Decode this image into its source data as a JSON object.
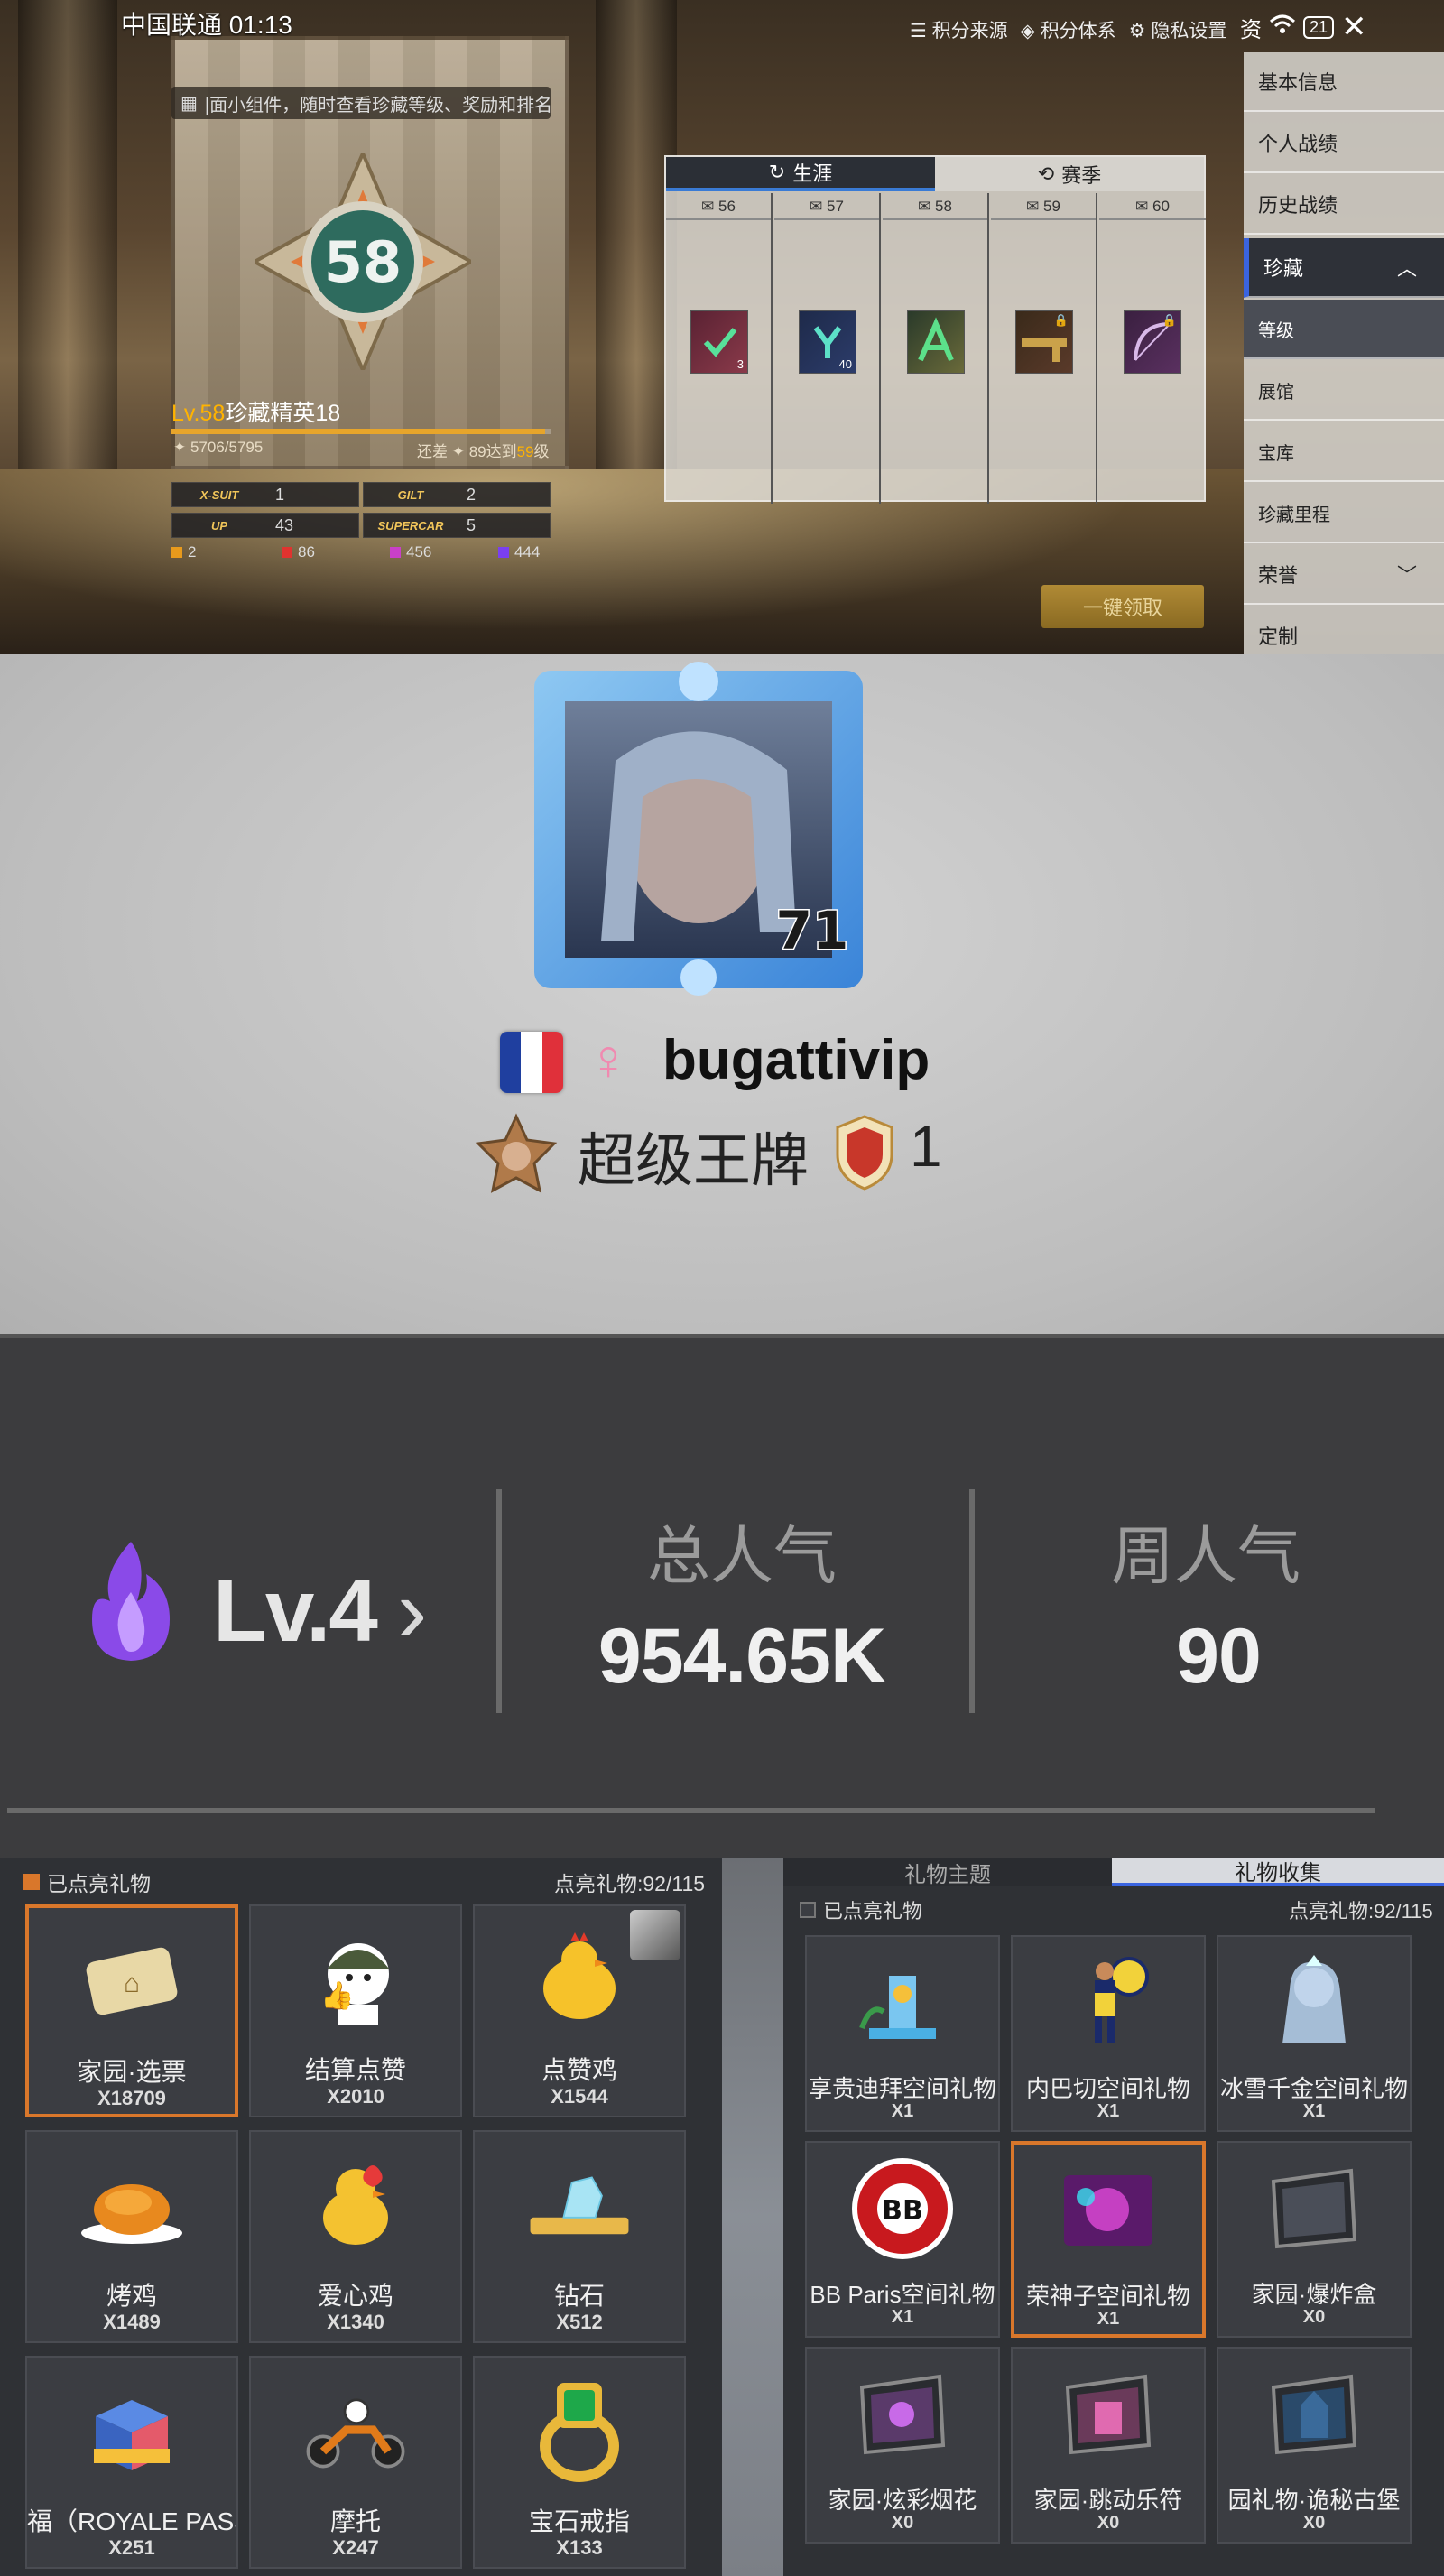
{
  "status": {
    "carrier_time": "中国联通 01:13",
    "battery": "21"
  },
  "top_links": [
    "积分来源",
    "积分体系",
    "隐私设置"
  ],
  "tip_banner": "|面小组件，随时查看珍藏等级、奖励和排名",
  "badge_level": "58",
  "level_line": {
    "lv": "Lv.58",
    "title": "珍藏精英18"
  },
  "xp": {
    "text": "5706/5795",
    "fraction": 0.985,
    "remain_prefix": "还差",
    "remain_value": "89达到",
    "remain_next": "59",
    "remain_suffix": "级"
  },
  "ranks": [
    {
      "logo": "X-SUIT",
      "value": "1"
    },
    {
      "logo": "GILT",
      "value": "2"
    },
    {
      "logo": "UP",
      "value": "43"
    },
    {
      "logo": "SUPERCAR",
      "value": "5"
    }
  ],
  "counts": [
    {
      "color": "#e89a1c",
      "value": "2"
    },
    {
      "color": "#e0332f",
      "value": "86"
    },
    {
      "color": "#c940c8",
      "value": "456"
    },
    {
      "color": "#7a3ff0",
      "value": "444"
    }
  ],
  "career_panel": {
    "tabs": [
      "生涯",
      "赛季"
    ],
    "columns": [
      {
        "level": "56",
        "qty": "3"
      },
      {
        "level": "57",
        "qty": "40"
      },
      {
        "level": "58",
        "qty": ""
      },
      {
        "level": "59",
        "qty": ""
      },
      {
        "level": "60",
        "qty": ""
      }
    ]
  },
  "side_menu": {
    "close_label": "资",
    "items": [
      "基本信息",
      "个人战绩",
      "历史战绩",
      "珍藏",
      "等级",
      "展馆",
      "宝库",
      "珍藏里程",
      "荣誉",
      "定制"
    ]
  },
  "claim_button": "一键领取",
  "profile": {
    "avatar_level": "71",
    "name": "bugattivip",
    "rank_title": "超级王牌",
    "rank_num": "1"
  },
  "popularity": {
    "level": "Lv.4",
    "total_label": "总人气",
    "total_value": "954.65K",
    "week_label": "周人气",
    "week_value": "90"
  },
  "gifts_left": {
    "header": "已点亮礼物",
    "lit_count": "点亮礼物:92/115",
    "items": [
      {
        "name": "家园·选票",
        "count": "X18709",
        "icon": "ticket-icon"
      },
      {
        "name": "结算点赞",
        "count": "X2010",
        "icon": "thumbs-up-icon"
      },
      {
        "name": "点赞鸡",
        "count": "X1544",
        "icon": "chicken-icon"
      },
      {
        "name": "烤鸡",
        "count": "X1489",
        "icon": "roast-chicken-icon"
      },
      {
        "name": "爱心鸡",
        "count": "X1340",
        "icon": "heart-chicken-icon"
      },
      {
        "name": "钻石",
        "count": "X512",
        "icon": "diamond-icon"
      },
      {
        "name": "福（ROYALE PASS专",
        "count": "X251",
        "icon": "gift-box-icon"
      },
      {
        "name": "摩托",
        "count": "X247",
        "icon": "motorcycle-icon"
      },
      {
        "name": "宝石戒指",
        "count": "X133",
        "icon": "ring-icon"
      }
    ]
  },
  "gifts_right": {
    "tabs": [
      "礼物主题",
      "礼物收集"
    ],
    "header": "已点亮礼物",
    "lit_count": "点亮礼物:92/115",
    "items": [
      {
        "name": "享贵迪拜空间礼物",
        "count": "X1",
        "icon": "dubai-icon"
      },
      {
        "name": "内巴切空间礼物",
        "count": "X1",
        "icon": "football-icon"
      },
      {
        "name": "冰雪千金空间礼物",
        "count": "X1",
        "icon": "snow-princess-icon"
      },
      {
        "name": "BB Paris空间礼物",
        "count": "X1",
        "icon": "balenciaga-icon",
        "logo_text": "BB"
      },
      {
        "name": "荣神子空间礼物",
        "count": "X1",
        "icon": "neon-room-icon"
      },
      {
        "name": "家园·爆炸盒",
        "count": "X0",
        "icon": "blast-box-icon"
      },
      {
        "name": "家园·炫彩烟花",
        "count": "X0",
        "icon": "fireworks-icon"
      },
      {
        "name": "家园·跳动乐符",
        "count": "X0",
        "icon": "music-note-icon"
      },
      {
        "name": "园礼物·诡秘古堡",
        "count": "X0",
        "icon": "castle-icon"
      }
    ]
  }
}
